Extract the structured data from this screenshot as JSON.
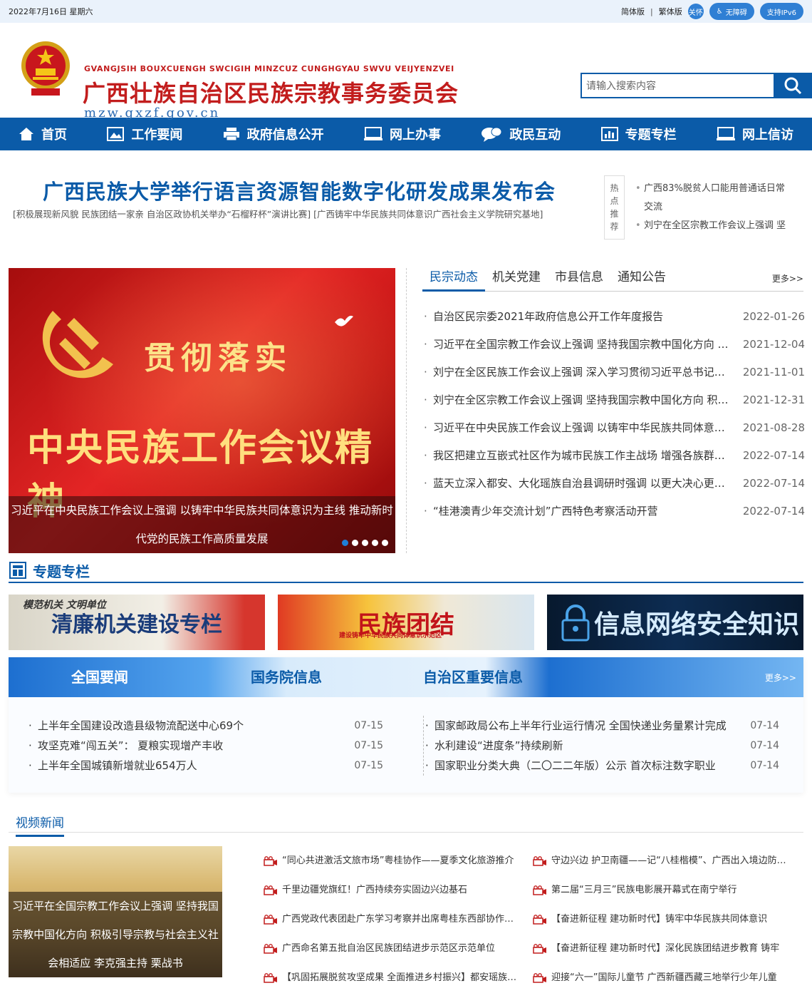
{
  "topbar": {
    "date": "2022年7月16日  星期六",
    "simplified": "简体版",
    "separator": "|",
    "traditional": "繁体版",
    "care_label": "关怀",
    "accessibility": "无障碍",
    "ipv6": "支持IPv6"
  },
  "header": {
    "name_zhuang": "GVANGJSIH BOUXCUENGH SWCIGIH MINZCUZ CUNGHGYAU SWVU VEIJYENZVEI",
    "name_cn": "广西壮族自治区民族宗教事务委员会",
    "url": "mzw.gxzf.gov.cn",
    "search_placeholder": "请输入搜索内容"
  },
  "nav": {
    "items": [
      {
        "label": "首页",
        "icon": "home-icon"
      },
      {
        "label": "工作要闻",
        "icon": "image-icon"
      },
      {
        "label": "政府信息公开",
        "icon": "printer-icon"
      },
      {
        "label": "网上办事",
        "icon": "monitor-icon"
      },
      {
        "label": "政民互动",
        "icon": "chat-icon"
      },
      {
        "label": "专题专栏",
        "icon": "chart-icon"
      },
      {
        "label": "网上信访",
        "icon": "monitor-icon"
      }
    ]
  },
  "headline": {
    "title": "广西民族大学举行语言资源智能数字化研发成果发布会",
    "subline": "[积极展现新风貌 民族团结一家亲 自治区政协机关举办“石榴籽杯”演讲比赛]   [广西铸牢中华民族共同体意识广西社会主义学院研究基地]"
  },
  "hot": {
    "label": [
      "热",
      "点",
      "推",
      "荐"
    ],
    "items": [
      "广西83%脱贫人口能用普通话日常",
      "交流",
      "刘宁在全区宗教工作会议上强调 坚"
    ]
  },
  "banner": {
    "text1": "贯彻落实",
    "text2": "中央民族工作会议精神",
    "caption": "习近平在中央民族工作会议上强调 以铸牢中华民族共同体意识为主线 推动新时代党的民族工作高质量发展"
  },
  "news_tabs": {
    "tabs": [
      "民宗动态",
      "机关党建",
      "市县信息",
      "通知公告"
    ],
    "more": "更多>>",
    "items": [
      {
        "title": "自治区民宗委2021年政府信息公开工作年度报告",
        "date": "2022-01-26"
      },
      {
        "title": "习近平在全国宗教工作会议上强调 坚持我国宗教中国化方向 积极引导宗教与社会主义社会相适应",
        "date": "2021-12-04"
      },
      {
        "title": "刘宁在全区民族工作会议上强调 深入学习贯彻习近平总书记关于加强和改进民族工作的重要思想",
        "date": "2021-11-01"
      },
      {
        "title": "刘宁在全区宗教工作会议上强调 坚持我国宗教中国化方向 积极引导宗教与社会主义社会相适应",
        "date": "2021-12-31"
      },
      {
        "title": "习近平在中央民族工作会议上强调 以铸牢中华民族共同体意识为主线 推动新时代党的民族工作高质量发展",
        "date": "2021-08-28"
      },
      {
        "title": "我区把建立互嵌式社区作为城市民族工作主战场 增强各族群众的获得感",
        "date": "2022-07-14"
      },
      {
        "title": "蓝天立深入都安、大化瑶族自治县调研时强调 以更大决心更实举措推进乡村振兴",
        "date": "2022-07-14"
      },
      {
        "title": "“桂港澳青少年交流计划”广西特色考察活动开营",
        "date": "2022-07-14"
      }
    ]
  },
  "special": {
    "title": "专题专栏",
    "features": [
      {
        "text": "清廉机关建设专栏",
        "small": "模范机关 文明单位"
      },
      {
        "text": "民族团结",
        "small": "建设铸牢中华民族共同体意识示范区"
      },
      {
        "text": "信息网络安全知识",
        "small": ""
      }
    ]
  },
  "gov": {
    "tabs": [
      "全国要闻",
      "国务院信息",
      "自治区重要信息"
    ],
    "more": "更多>>",
    "left": [
      {
        "title": "上半年全国建设改造县级物流配送中心69个",
        "date": "07-15"
      },
      {
        "title": "攻坚克难“闯五关”： 夏粮实现增产丰收",
        "date": "07-15"
      },
      {
        "title": "上半年全国城镇新增就业654万人",
        "date": "07-15"
      }
    ],
    "right": [
      {
        "title": "国家邮政局公布上半年行业运行情况 全国快递业务量累计完成",
        "date": "07-14"
      },
      {
        "title": "水利建设“进度条”持续刷新",
        "date": "07-14"
      },
      {
        "title": "国家职业分类大典（二〇二二年版）公示 首次标注数字职业",
        "date": "07-14"
      }
    ]
  },
  "video": {
    "tab": "视频新闻",
    "caption": "习近平在全国宗教工作会议上强调 坚持我国宗教中国化方向 积极引导宗教与社会主义社会相适应 李克强主持 栗战书",
    "left": [
      "“同心共进激活文旅市场”粤桂协作——夏季文化旅游推介",
      "千里边疆党旗红！广西持续夯实固边兴边基石",
      "广西党政代表团赴广东学习考察并出席粤桂东西部协作联席会议",
      "广西命名第五批自治区民族团结进步示范区示范单位",
      "【巩固拓展脱贫攻坚成果 全面推进乡村振兴】都安瑶族自治县"
    ],
    "right": [
      "守边兴边 护卫南疆——记“八桂楷模”、广西出入境边防检查",
      "第二届“三月三”民族电影展开幕式在南宁举行",
      "【奋进新征程 建功新时代】铸牢中华民族共同体意识",
      "【奋进新征程 建功新时代】深化民族团结进步教育 铸牢",
      "迎接“六一”国际儿童节 广西新疆西藏三地举行少年儿童"
    ]
  },
  "colors": {
    "primary": "#0b5ba8",
    "brand_red": "#c21d1d"
  }
}
